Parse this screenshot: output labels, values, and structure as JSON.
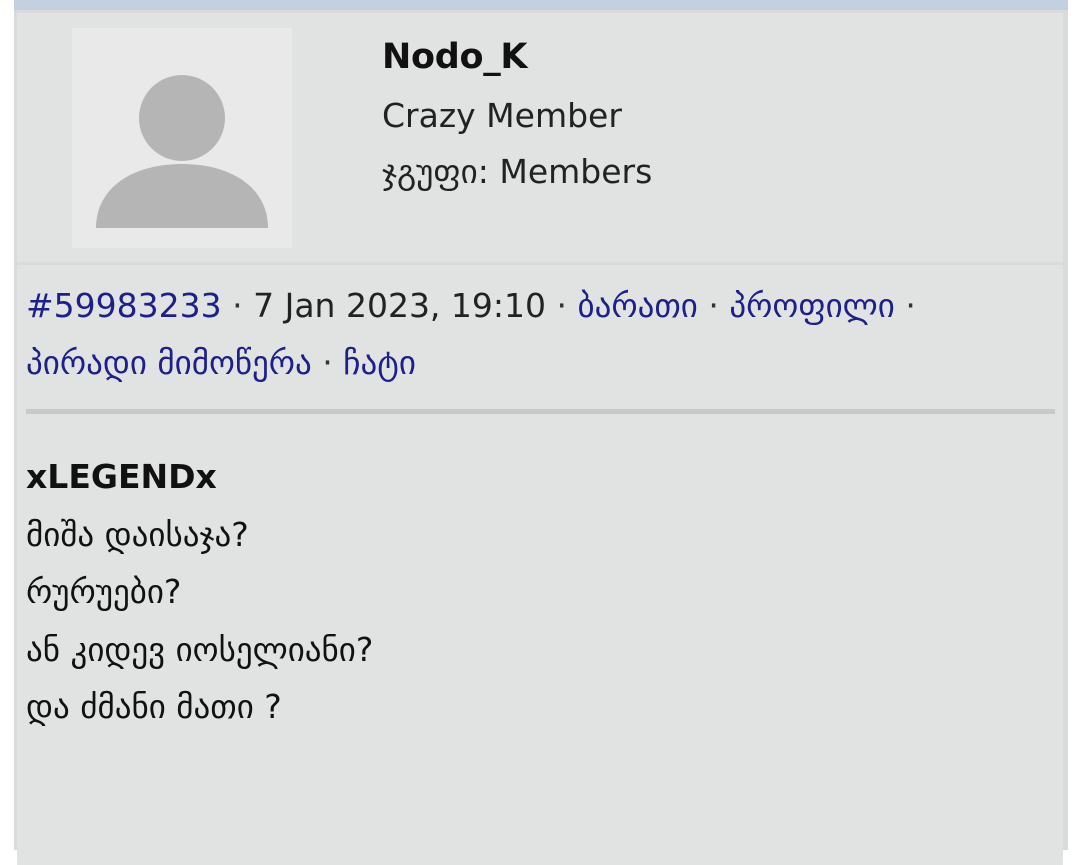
{
  "user": {
    "name": "Nodo_K",
    "rank": "Crazy Member",
    "group_label": "ჯგუფი:",
    "group_value": "Members",
    "avatar_icon": "default-user-icon"
  },
  "post": {
    "id": "#59983233",
    "separator": " · ",
    "datetime": "7 Jan 2023, 19:10",
    "links": {
      "card": "ბარათი",
      "profile": "პროფილი",
      "pm": "პირადი მიმოწერა",
      "chat": "ჩატი"
    },
    "quote_author": "xLEGENDx",
    "lines": [
      "მიშა დაისაჯა?",
      "რურუები?",
      "ან კიდევ იოსელიანი?",
      "და ძმანი მათი ?"
    ]
  },
  "colors": {
    "link": "#1d1f8a",
    "panel": "#e1e3e3",
    "topbar": "#c3d0df"
  }
}
